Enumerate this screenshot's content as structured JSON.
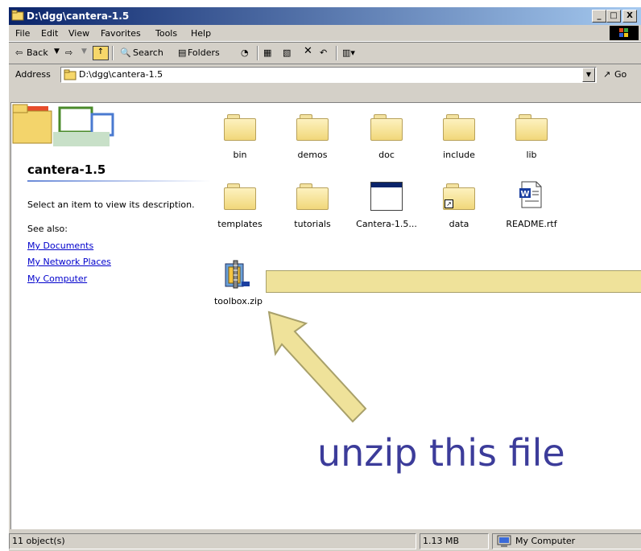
{
  "window": {
    "title": "D:\\dgg\\cantera-1.5",
    "minimize": "_",
    "maximize": "□",
    "close": "X"
  },
  "menu": [
    "File",
    "Edit",
    "View",
    "Favorites",
    "Tools",
    "Help"
  ],
  "toolbar": {
    "back": "Back",
    "search": "Search",
    "folders": "Folders"
  },
  "address": {
    "label": "Address",
    "value": "D:\\dgg\\cantera-1.5",
    "go": "Go"
  },
  "sidepanel": {
    "folder_name": "cantera-1.5",
    "description": "Select an item to view its description.",
    "see_also": "See also:",
    "links": [
      "My Documents",
      "My Network Places",
      "My Computer"
    ]
  },
  "files": [
    {
      "name": "bin",
      "type": "folder"
    },
    {
      "name": "demos",
      "type": "folder"
    },
    {
      "name": "doc",
      "type": "folder"
    },
    {
      "name": "include",
      "type": "folder"
    },
    {
      "name": "lib",
      "type": "folder"
    },
    {
      "name": "templates",
      "type": "folder"
    },
    {
      "name": "tutorials",
      "type": "folder"
    },
    {
      "name": "Cantera-1.5...",
      "type": "window"
    },
    {
      "name": "data",
      "type": "folder-shortcut"
    },
    {
      "name": "README.rtf",
      "type": "word-doc"
    },
    {
      "name": "toolbox.zip",
      "type": "zip"
    }
  ],
  "status": {
    "objects": "11 object(s)",
    "size": "1.13 MB",
    "location": "My Computer"
  },
  "annotation": {
    "text": "unzip this file",
    "color": "#3c3c9a",
    "arrow_fill": "#efe29a",
    "arrow_stroke": "#a8a06a"
  }
}
